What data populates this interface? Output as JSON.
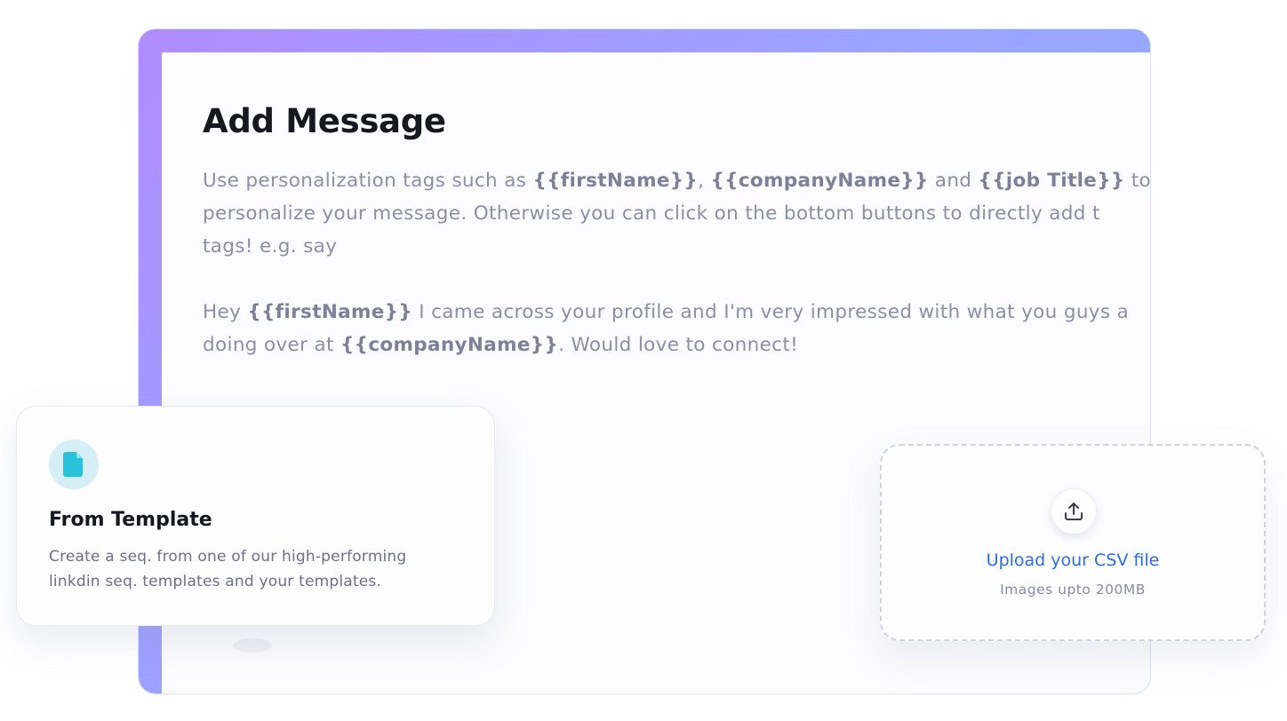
{
  "main": {
    "title": "Add Message",
    "description": {
      "line1": {
        "p1": "Use personalization tags such as ",
        "tag1": "{{firstName}}",
        "p2": ", ",
        "tag2": "{{companyName}}",
        "p3": " and ",
        "tag3": "{{job Title}}",
        "p4": " to"
      },
      "line2": "personalize your message. Otherwise you can click on the bottom buttons to directly add t",
      "line3": "tags! e.g. say",
      "example": {
        "p1": "Hey ",
        "tag1": "{{firstName}}",
        "p2": " I came across your profile and I'm very impressed with what you guys a",
        "p3": "doing over at ",
        "tag2": "{{companyName}}",
        "p4": ". Would love to connect!"
      }
    }
  },
  "template_card": {
    "icon": "document-icon",
    "title": "From Template",
    "desc_line1": "Create a seq. from one of our high-performing",
    "desc_line2": "linkdin seq. templates and your templates."
  },
  "upload_card": {
    "icon": "upload-icon",
    "label": "Upload your CSV file",
    "hint": "Images upto 200MB"
  },
  "colors": {
    "accent_gradient_start": "#b08cff",
    "accent_gradient_end": "#8fb2ff",
    "link_blue": "#2f6be6",
    "template_icon_bg": "#d4eff5",
    "template_icon_fg": "#29c2d9"
  }
}
